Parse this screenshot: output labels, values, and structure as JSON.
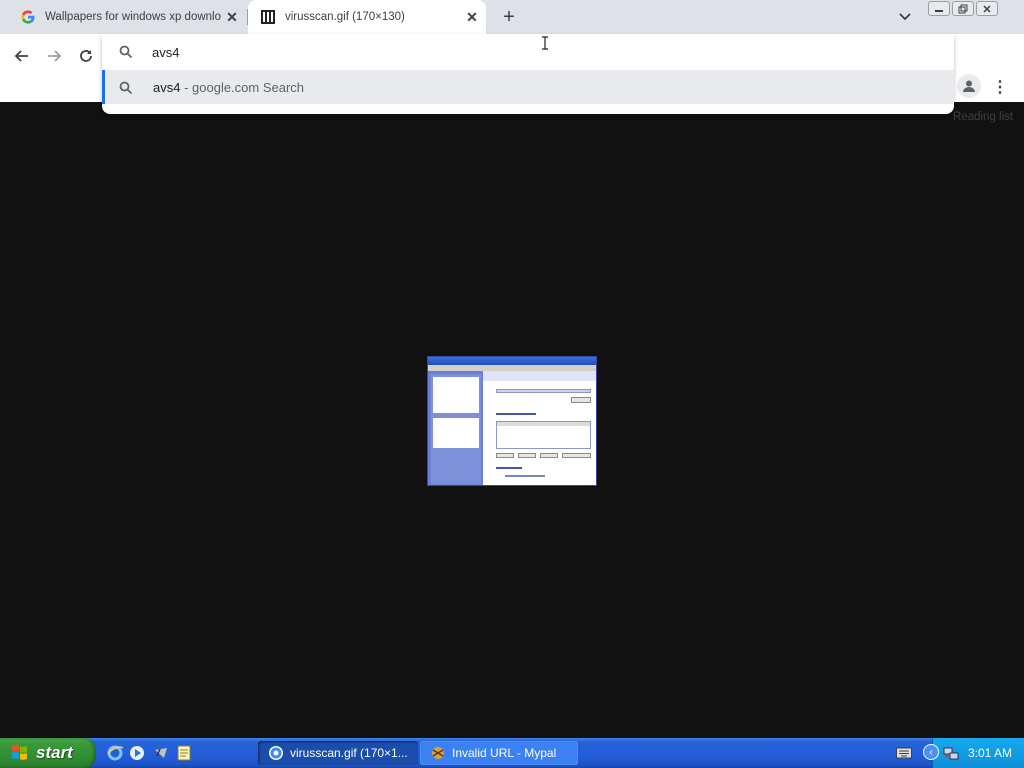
{
  "browser": {
    "tabs": [
      {
        "title": "Wallpapers for windows xp downlo",
        "favicon": "google-icon",
        "active": false
      },
      {
        "title": "virusscan.gif (170×130)",
        "favicon": "image-file-icon",
        "active": true
      }
    ],
    "new_tab_symbol": "+",
    "close_symbol": "✕",
    "window_controls": [
      "minimize",
      "restore",
      "close"
    ],
    "reading_list_label": "Reading list",
    "menu_symbol": "⋮"
  },
  "omnibox": {
    "input_value": "avs4",
    "suggestions": [
      {
        "query": "avs4",
        "suffix": " - google.com Search",
        "icon": "search-icon"
      }
    ]
  },
  "content": {
    "image_name": "virusscan.gif",
    "background": "#111111"
  },
  "taskbar": {
    "start_label": "start",
    "quick_launch": [
      "internet-explorer-icon",
      "media-player-icon",
      "mouse-tool-icon",
      "notepad-icon"
    ],
    "items": [
      {
        "label": "virusscan.gif (170×1...",
        "icon": "chrome-icon",
        "active": true
      },
      {
        "label": "Invalid URL - Mypal",
        "icon": "mypal-icon",
        "active": false
      }
    ],
    "clock": "3:01 AM"
  },
  "colors": {
    "accent": "#1a73e8",
    "taskbar_blue": "#245edb",
    "start_green": "#3a9a3c",
    "tray_blue": "#0f8fd8"
  }
}
